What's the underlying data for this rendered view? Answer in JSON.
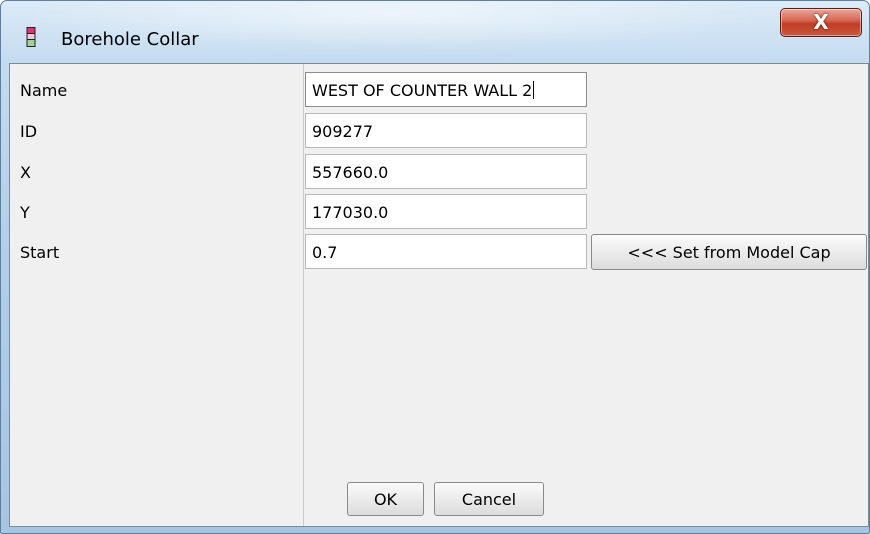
{
  "window": {
    "title": "Borehole Collar",
    "close_label": "X"
  },
  "form": {
    "rows": [
      {
        "label": "Name",
        "value": "WEST OF COUNTER WALL 2"
      },
      {
        "label": "ID",
        "value": "909277"
      },
      {
        "label": "X",
        "value": "557660.0"
      },
      {
        "label": "Y",
        "value": "177030.0"
      },
      {
        "label": "Start",
        "value": "0.7"
      }
    ],
    "set_from_model_cap_label": "<<< Set from Model Cap"
  },
  "buttons": {
    "ok_label": "OK",
    "cancel_label": "Cancel"
  },
  "colors": {
    "title_bar": "#b3cfe9",
    "close_button": "#c13e26",
    "dialog_background": "#f0f0f0",
    "icon_accent": "#d4245c"
  },
  "icons": {
    "app_icon": "borehole-icon"
  }
}
